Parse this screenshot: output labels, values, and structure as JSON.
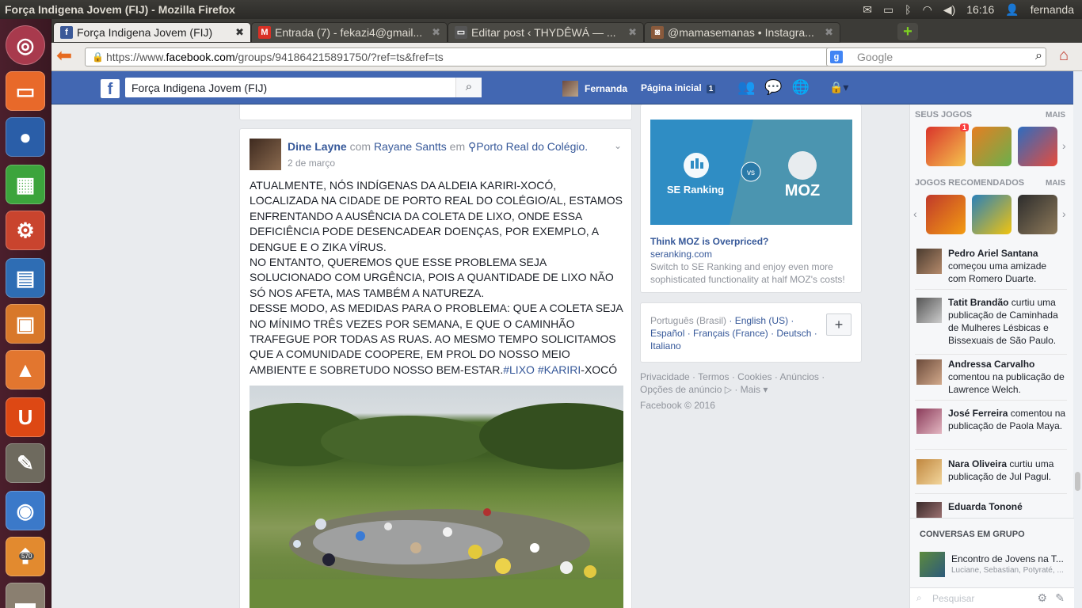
{
  "os": {
    "window_title": "Força Indigena Jovem (FIJ) - Mozilla Firefox",
    "clock": "16:16",
    "user": "fernanda",
    "launcher_badge": "570"
  },
  "browser": {
    "tabs": [
      {
        "label": "Força Indigena Jovem (FIJ)",
        "icon": "facebook-icon",
        "active": true
      },
      {
        "label": "Entrada (7) - fekazi4@gmail...",
        "icon": "gmail-icon",
        "active": false
      },
      {
        "label": "Editar post ‹ THYDÊWÁ — ...",
        "icon": "wordpress-icon",
        "active": false
      },
      {
        "label": "@mamasemanas • Instagra...",
        "icon": "instagram-icon",
        "active": false
      }
    ],
    "url_prefix": "https://www.",
    "url_host": "facebook.com",
    "url_path": "/groups/941864215891750/?ref=ts&fref=ts",
    "search_placeholder": "Google"
  },
  "facebook": {
    "search_value": "Força Indigena Jovem (FIJ)",
    "user_name": "Fernanda",
    "home_label": "Página inicial",
    "home_count": "1"
  },
  "post": {
    "author": "Dine Layne",
    "with_word": "com",
    "tagged": "Rayane Santts",
    "at_word": "em",
    "location": "Porto Real do Colégio.",
    "date": "2 de março",
    "text_main": "ATUALMENTE, NÓS INDÍGENAS DA ALDEIA KARIRI-XOCÓ, LOCALIZADA NA CIDADE DE PORTO REAL DO COLÉGIO/AL, ESTAMOS ENFRENTANDO A AUSÊNCIA DA COLETA DE LIXO, ONDE ESSA DEFICIÊNCIA PODE DESENCADEAR DOENÇAS, POR EXEMPLO, A DENGUE E O ZIKA VÍRUS.\nNO ENTANTO, QUEREMOS QUE ESSE PROBLEMA SEJA SOLUCIONADO COM URGÊNCIA, POIS A QUANTIDADE DE LIXO NÃO SÓ NOS AFETA, MAS TAMBÉM A NATUREZA.\nDESSE MODO, AS MEDIDAS PARA O PROBLEMA: QUE A COLETA SEJA NO MÍNIMO TRÊS VEZES POR SEMANA, E QUE O CAMINHÃO TRAFEGUE POR TODAS AS RUAS. AO MESMO TEMPO SOLICITAMOS QUE A COMUNIDADE COOPERE, EM PROL DO NOSSO MEIO AMBIENTE E SOBRETUDO NOSSO BEM-ESTAR.",
    "hashtag1": "#LIXO",
    "hashtag2": "#KARIRI",
    "text_end": "-XOCÓ"
  },
  "ad": {
    "banner_left": "SE Ranking",
    "banner_vs": "vs",
    "banner_right": "MOZ",
    "title": "Think MOZ is Overpriced?",
    "site": "seranking.com",
    "description": "Switch to SE Ranking and enjoy even more sophisticated functionality at half MOZ's costs!"
  },
  "languages": {
    "current": "Português (Brasil)",
    "others": [
      "English (US)",
      "Español",
      "Français (France)",
      "Deutsch",
      "Italiano"
    ]
  },
  "footer": {
    "links": [
      "Privacidade",
      "Termos",
      "Cookies",
      "Anúncios",
      "Opções de anúncio",
      "Mais"
    ],
    "copyright": "Facebook © 2016"
  },
  "sidebar": {
    "my_games_label": "SEUS JOGOS",
    "recommended_label": "JOGOS RECOMENDADOS",
    "more_label": "MAIS",
    "game_badge": "1",
    "ticker": [
      {
        "name": "Pedro Ariel Santana",
        "rest": " começou uma amizade com Romero Duarte."
      },
      {
        "name": "Tatit Brandão",
        "rest": " curtiu uma publicação de Caminhada de Mulheres Lésbicas e Bissexuais de São Paulo."
      },
      {
        "name": "Andressa Carvalho",
        "rest": " comentou na publicação de Lawrence Welch."
      },
      {
        "name": "José Ferreira",
        "rest": " comentou na publicação de Paola Maya."
      },
      {
        "name": "Nara Oliveira",
        "rest": " curtiu uma publicação de Jul Pagul."
      },
      {
        "name": "Eduarda Tononé",
        "rest": ""
      }
    ],
    "group_conversations_label": "CONVERSAS EM GRUPO",
    "group_name": "Encontro de Jovens na T...",
    "group_members": "Luciane, Sebastian, Potyraté, ...",
    "chat_search_placeholder": "Pesquisar"
  }
}
